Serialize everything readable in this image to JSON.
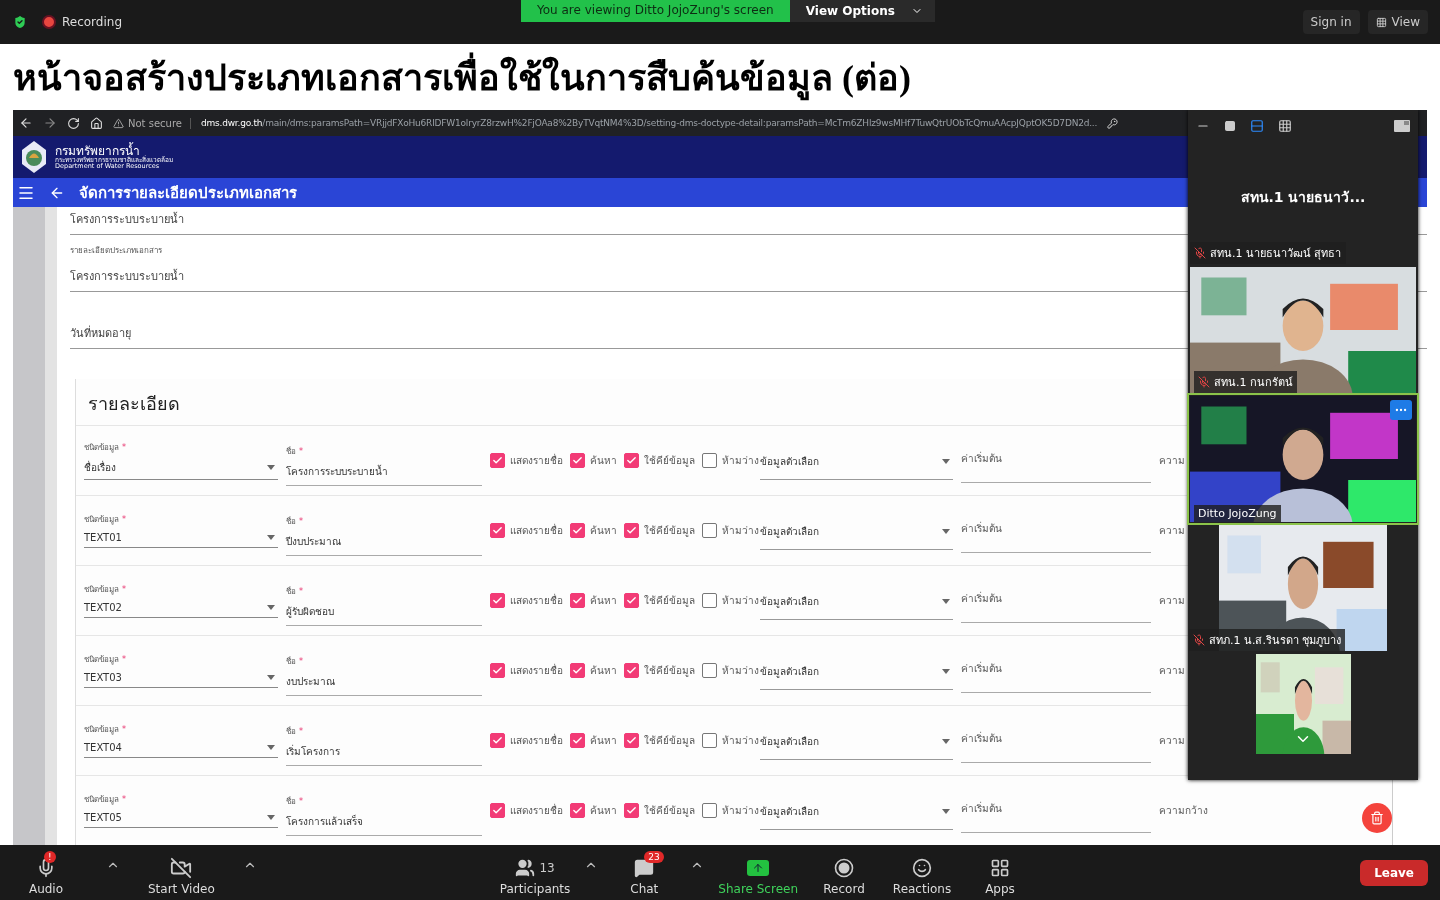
{
  "meeting_bar": {
    "recording": "Recording",
    "banner": "You are viewing Ditto JojoZung's screen",
    "view_options": "View Options",
    "sign_in": "Sign in",
    "view": "View"
  },
  "slide_title": "หน้าจอสร้างประเภทเอกสารเพื่อใช้ในการสืบค้นข้อมูล (ต่อ)",
  "browser": {
    "security": "Not secure",
    "domain": "dms.dwr.go.th",
    "path": "/main/dms:paramsPath=VRjjdFXoHu6RIDFW1olryrZ8rzwH%2FjOAa8%2ByTVqtNM4%3D/setting-dms-doctype-detail:paramsPath=McTm6ZHlz9wsMHf7TuwQtrUObTcQmuAAcpJQptOK5D7DN2d..."
  },
  "site": {
    "org_name": "กรมทรัพยากรน้ำ",
    "org_ministry": "กระทรวงทรัพยากรธรรมชาติและสิ่งแวดล้อม",
    "org_english": "Department of Water Resources",
    "page_title": "จัดการรายละเอียดประเภทเอกสาร"
  },
  "form_fields": [
    {
      "value": "โครงการระบบระบายน้ำ"
    },
    {
      "label": "รายละเอียดประเภทเอกสาร",
      "value": "โครงการระบบระบายน้ำ"
    },
    {
      "placeholder": "วันที่หมดอายุ"
    }
  ],
  "details": {
    "title": "รายละเอียด",
    "rows": [
      {
        "type_label": "ชนิดข้อมูล",
        "type_mark": "*",
        "type": "ชื่อเรื่อง",
        "name_label": "ชื่อ",
        "name_mark": "*",
        "name": "โครงการระบบระบายน้ำ",
        "options": [
          {
            "label": "แสดงรายชื่อ",
            "checked": true
          },
          {
            "label": "ค้นหา",
            "checked": true
          },
          {
            "label": "ใช้คีย์ข้อมูล",
            "checked": true
          },
          {
            "label": "ห้ามว่าง",
            "checked": false
          }
        ],
        "choice": "ข้อมูลตัวเลือก",
        "default_placeholder": "ค่าเริ่มต้น",
        "width_label": "ความ"
      },
      {
        "type_label": "ชนิดข้อมูล",
        "type_mark": "*",
        "type": "TEXT01",
        "name_label": "ชื่อ",
        "name_mark": "*",
        "name": "ปีงบประมาณ",
        "options": [
          {
            "label": "แสดงรายชื่อ",
            "checked": true
          },
          {
            "label": "ค้นหา",
            "checked": true
          },
          {
            "label": "ใช้คีย์ข้อมูล",
            "checked": true
          },
          {
            "label": "ห้ามว่าง",
            "checked": false
          }
        ],
        "choice": "ข้อมูลตัวเลือก",
        "default_placeholder": "ค่าเริ่มต้น",
        "width_label": "ความ"
      },
      {
        "type_label": "ชนิดข้อมูล",
        "type_mark": "*",
        "type": "TEXT02",
        "name_label": "ชื่อ",
        "name_mark": "*",
        "name": "ผู้รับผิดชอบ",
        "options": [
          {
            "label": "แสดงรายชื่อ",
            "checked": true
          },
          {
            "label": "ค้นหา",
            "checked": true
          },
          {
            "label": "ใช้คีย์ข้อมูล",
            "checked": true
          },
          {
            "label": "ห้ามว่าง",
            "checked": false
          }
        ],
        "choice": "ข้อมูลตัวเลือก",
        "default_placeholder": "ค่าเริ่มต้น",
        "width_label": "ความ"
      },
      {
        "type_label": "ชนิดข้อมูล",
        "type_mark": "*",
        "type": "TEXT03",
        "name_label": "ชื่อ",
        "name_mark": "*",
        "name": "งบประมาณ",
        "options": [
          {
            "label": "แสดงรายชื่อ",
            "checked": true
          },
          {
            "label": "ค้นหา",
            "checked": true
          },
          {
            "label": "ใช้คีย์ข้อมูล",
            "checked": true
          },
          {
            "label": "ห้ามว่าง",
            "checked": false
          }
        ],
        "choice": "ข้อมูลตัวเลือก",
        "default_placeholder": "ค่าเริ่มต้น",
        "width_label": "ความ"
      },
      {
        "type_label": "ชนิดข้อมูล",
        "type_mark": "*",
        "type": "TEXT04",
        "name_label": "ชื่อ",
        "name_mark": "*",
        "name": "เริ่มโครงการ",
        "options": [
          {
            "label": "แสดงรายชื่อ",
            "checked": true
          },
          {
            "label": "ค้นหา",
            "checked": true
          },
          {
            "label": "ใช้คีย์ข้อมูล",
            "checked": true
          },
          {
            "label": "ห้ามว่าง",
            "checked": false
          }
        ],
        "choice": "ข้อมูลตัวเลือก",
        "default_placeholder": "ค่าเริ่มต้น",
        "width_label": "ความ"
      },
      {
        "type_label": "ชนิดข้อมูล",
        "type_mark": "*",
        "type": "TEXT05",
        "name_label": "ชื่อ",
        "name_mark": "*",
        "name": "โครงการแล้วเสร็จ",
        "options": [
          {
            "label": "แสดงรายชื่อ",
            "checked": true
          },
          {
            "label": "ค้นหา",
            "checked": true
          },
          {
            "label": "ใช้คีย์ข้อมูล",
            "checked": true
          },
          {
            "label": "ห้ามว่าง",
            "checked": false
          }
        ],
        "choice": "ข้อมูลตัวเลือก",
        "default_placeholder": "ค่าเริ่มต้น",
        "width_label": "ความกว้าง"
      }
    ]
  },
  "gallery": {
    "speaker": "สทน.1 นายธนาวั...",
    "tiles": [
      {
        "kind": "name",
        "name": "สทน.1 นายธนาวัฒน์ สุทธา",
        "muted": true,
        "active": false
      },
      {
        "kind": "video",
        "name": "สทน.1 กนกรัตน์",
        "muted": true,
        "active": false
      },
      {
        "kind": "video",
        "name": "Ditto JojoZung",
        "muted": false,
        "active": true
      },
      {
        "kind": "video",
        "name": "สทภ.1 น.ส.รินรดา ชุมภูบาง",
        "muted": true,
        "active": false
      },
      {
        "kind": "video",
        "active": false
      }
    ]
  },
  "toolbar": {
    "left": [
      {
        "kind": "audio",
        "label": "Audio",
        "badge": "!",
        "menu": true
      },
      {
        "kind": "video",
        "label": "Start Video",
        "menu": true
      }
    ],
    "center": [
      {
        "kind": "participants",
        "label": "Participants",
        "count": "13",
        "menu": true
      },
      {
        "kind": "chat",
        "label": "Chat",
        "badge": "23",
        "menu": true
      },
      {
        "kind": "share",
        "label": "Share Screen",
        "menu": false
      },
      {
        "kind": "record",
        "label": "Record",
        "menu": false
      },
      {
        "kind": "reactions",
        "label": "Reactions",
        "menu": false
      },
      {
        "kind": "apps",
        "label": "Apps",
        "menu": false
      }
    ],
    "leave": "Leave"
  }
}
